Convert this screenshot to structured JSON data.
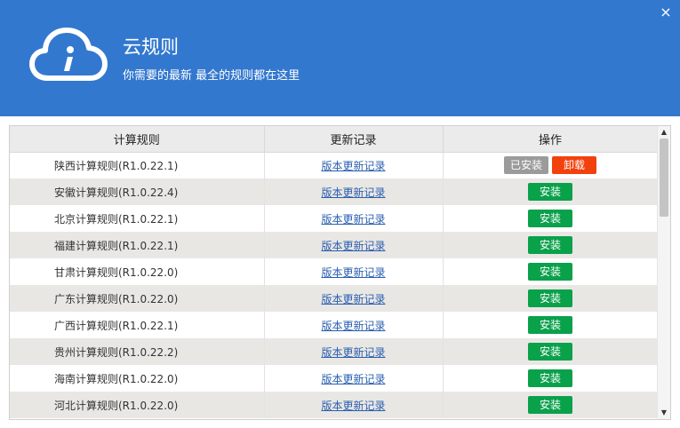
{
  "header": {
    "title": "云规则",
    "subtitle": "你需要的最新 最全的规则都在这里",
    "close_glyph": "×",
    "logo_glyph": "i",
    "colors": {
      "background": "#3378cf",
      "text": "#ffffff"
    }
  },
  "table": {
    "columns": [
      "计算规则",
      "更新记录",
      "操作"
    ],
    "rows": [
      {
        "name": "陕西计算规则(R1.0.22.1)",
        "log": "版本更新记录",
        "installed": true
      },
      {
        "name": "安徽计算规则(R1.0.22.4)",
        "log": "版本更新记录",
        "installed": false
      },
      {
        "name": "北京计算规则(R1.0.22.1)",
        "log": "版本更新记录",
        "installed": false
      },
      {
        "name": "福建计算规则(R1.0.22.1)",
        "log": "版本更新记录",
        "installed": false
      },
      {
        "name": "甘肃计算规则(R1.0.22.0)",
        "log": "版本更新记录",
        "installed": false
      },
      {
        "name": "广东计算规则(R1.0.22.0)",
        "log": "版本更新记录",
        "installed": false
      },
      {
        "name": "广西计算规则(R1.0.22.1)",
        "log": "版本更新记录",
        "installed": false
      },
      {
        "name": "贵州计算规则(R1.0.22.2)",
        "log": "版本更新记录",
        "installed": false
      },
      {
        "name": "海南计算规则(R1.0.22.0)",
        "log": "版本更新记录",
        "installed": false
      },
      {
        "name": "河北计算规则(R1.0.22.0)",
        "log": "版本更新记录",
        "installed": false
      }
    ],
    "actions": {
      "install": "安装",
      "installed": "已安装",
      "uninstall": "卸载"
    },
    "colors": {
      "install": "#0aa14b",
      "installed": "#9b9b9b",
      "uninstall": "#f2410c",
      "link": "#2a5fb0"
    }
  },
  "scrollbar": {
    "up_glyph": "▲",
    "down_glyph": "▼"
  }
}
